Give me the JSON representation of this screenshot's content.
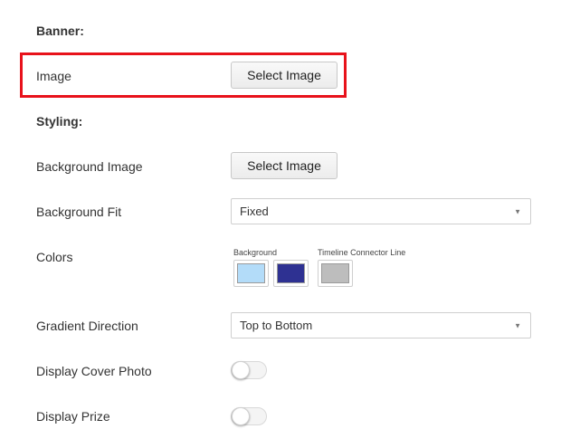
{
  "banner": {
    "title": "Banner:",
    "image_label": "Image",
    "select_image_button": "Select Image"
  },
  "styling": {
    "title": "Styling:",
    "background_image_label": "Background Image",
    "background_image_button": "Select Image",
    "background_fit_label": "Background Fit",
    "background_fit_value": "Fixed",
    "colors_label": "Colors",
    "colors": {
      "background_label": "Background",
      "timeline_label": "Timeline Connector Line",
      "swatch_1": "#b3dcf9",
      "swatch_2": "#2e3192",
      "swatch_3": "#bdbdbd"
    },
    "gradient_direction_label": "Gradient Direction",
    "gradient_direction_value": "Top to Bottom",
    "display_cover_photo_label": "Display Cover Photo",
    "display_cover_photo_on": false,
    "display_prize_label": "Display Prize",
    "display_prize_on": false
  },
  "highlight_color": "#e8121b"
}
